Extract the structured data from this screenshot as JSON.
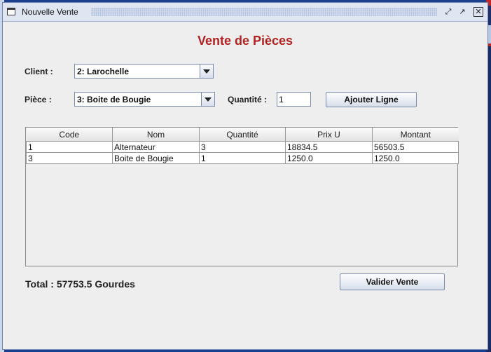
{
  "window": {
    "title": "Nouvelle Vente"
  },
  "heading": "Vente de Pièces",
  "client": {
    "label": "Client :",
    "selected": "2: Larochelle"
  },
  "piece": {
    "label": "Pièce :",
    "selected": "3: Boite de Bougie"
  },
  "quantite": {
    "label": "Quantité :",
    "value": "1"
  },
  "buttons": {
    "add_line": "Ajouter Ligne",
    "validate": "Valider Vente"
  },
  "table": {
    "columns": [
      "Code",
      "Nom",
      "Quantité",
      "Prix U",
      "Montant"
    ],
    "rows": [
      [
        "1",
        "Alternateur",
        "3",
        "18834.5",
        "56503.5"
      ],
      [
        "3",
        "Boite de Bougie",
        "1",
        "1250.0",
        "1250.0"
      ]
    ]
  },
  "total": "Total : 57753.5 Gourdes",
  "colors": {
    "heading": "#b22222",
    "titlebar": "#dfe6f2"
  }
}
